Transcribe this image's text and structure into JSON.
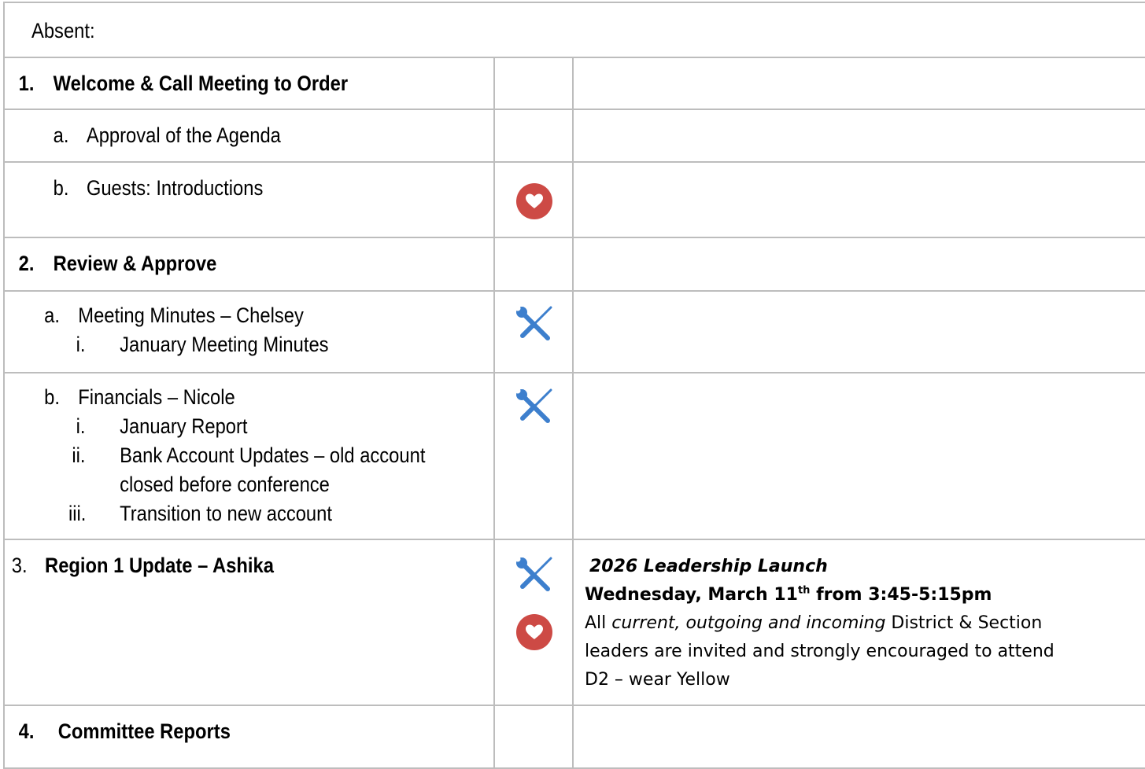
{
  "absent_label": "Absent:",
  "rows": {
    "welcome": {
      "num": "1.",
      "label": "Welcome & Call Meeting to Order"
    },
    "agenda": {
      "num": "a.",
      "label": "Approval of the Agenda"
    },
    "guests": {
      "num": "b.",
      "label": "Guests: Introductions"
    },
    "review": {
      "num": "2.",
      "label": "Review & Approve"
    },
    "minutes": {
      "num": "a.",
      "label": "Meeting Minutes – Chelsey",
      "sub": [
        {
          "num": "i.",
          "label": "January Meeting Minutes"
        }
      ]
    },
    "financials": {
      "num": "b.",
      "label": "Financials – Nicole",
      "sub": [
        {
          "num": "i.",
          "label": "January Report"
        },
        {
          "num": "ii.",
          "label": "Bank Account Updates – old account"
        },
        {
          "num": "",
          "label": "closed before conference"
        },
        {
          "num": "iii.",
          "label": "Transition to new account"
        }
      ]
    },
    "region": {
      "num": "3.",
      "label": "Region 1 Update – Ashika"
    },
    "committee": {
      "num": "4.",
      "label": "Committee Reports"
    }
  },
  "region_notes": {
    "title": "2026 Leadership Launch",
    "date_pre": "Wednesday, March 11",
    "date_sup": "th",
    "date_post": " from 3:45-5:15pm",
    "line3_a": "All ",
    "line3_b": "current, outgoing and incoming",
    "line3_c": " District & Section",
    "line4": "leaders are invited and strongly encouraged to attend",
    "line5": "D2 – wear Yellow"
  },
  "icons": {
    "wrench": "wrench-screwdriver-icon",
    "heart": "heart-icon",
    "wrench_color": "#3d7fcd",
    "heart_color": "#cd4a45"
  }
}
